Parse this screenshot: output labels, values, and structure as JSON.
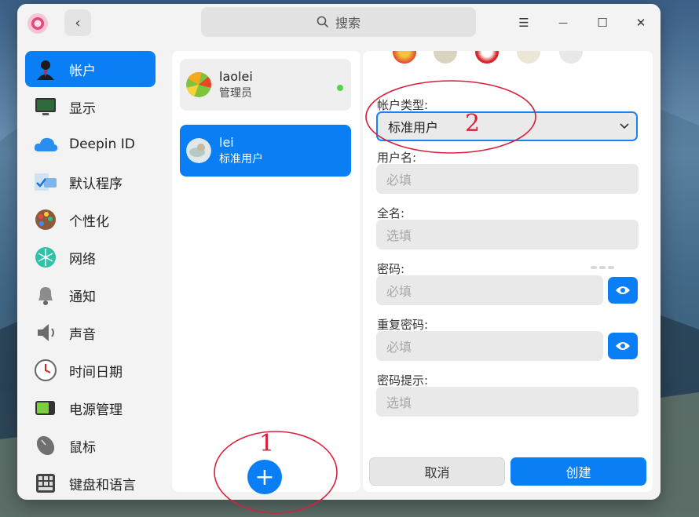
{
  "titlebar": {
    "search_placeholder": "搜索",
    "back_symbol": "‹",
    "menu_symbol": "☰",
    "minimize_symbol": "—",
    "maximize_symbol": "☐",
    "close_symbol": "✕"
  },
  "sidebar": {
    "items": [
      {
        "label": "帐户",
        "icon": "user-account-icon",
        "active": true
      },
      {
        "label": "显示",
        "icon": "display-icon",
        "active": false
      },
      {
        "label": "Deepin ID",
        "icon": "cloud-icon",
        "active": false
      },
      {
        "label": "默认程序",
        "icon": "default-apps-icon",
        "active": false
      },
      {
        "label": "个性化",
        "icon": "palette-icon",
        "active": false
      },
      {
        "label": "网络",
        "icon": "network-icon",
        "active": false
      },
      {
        "label": "通知",
        "icon": "bell-icon",
        "active": false
      },
      {
        "label": "声音",
        "icon": "speaker-icon",
        "active": false
      },
      {
        "label": "时间日期",
        "icon": "clock-icon",
        "active": false
      },
      {
        "label": "电源管理",
        "icon": "battery-icon",
        "active": false
      },
      {
        "label": "鼠标",
        "icon": "mouse-icon",
        "active": false
      },
      {
        "label": "键盘和语言",
        "icon": "keyboard-icon",
        "active": false
      }
    ]
  },
  "users": [
    {
      "name": "laolei",
      "role": "管理员",
      "selected": false,
      "online": true
    },
    {
      "name": "lei",
      "role": "标准用户",
      "selected": true,
      "online": false
    }
  ],
  "add_user_symbol": "+",
  "form": {
    "account_type_label": "帐户类型:",
    "account_type_value": "标准用户",
    "username_label": "用户名:",
    "username_placeholder": "必填",
    "fullname_label": "全名:",
    "fullname_placeholder": "选填",
    "password_label": "密码:",
    "password_placeholder": "必填",
    "repeat_password_label": "重复密码:",
    "repeat_password_placeholder": "必填",
    "hint_label": "密码提示:",
    "hint_placeholder": "选填",
    "cancel_label": "取消",
    "create_label": "创建"
  },
  "annotations": {
    "marker_1": "1",
    "marker_2": "2"
  },
  "colors": {
    "accent": "#0a7ef5",
    "annotation": "#d8203a",
    "online": "#51d34a"
  }
}
